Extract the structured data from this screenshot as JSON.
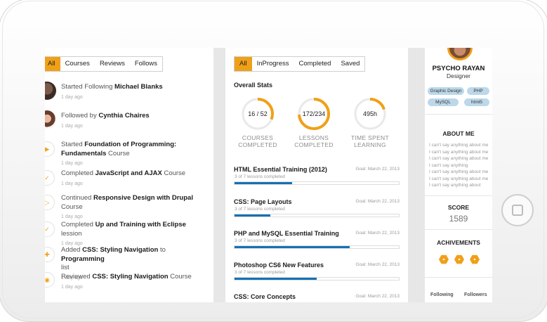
{
  "colors": {
    "accent": "#f0a018",
    "progress": "#1670b4",
    "tag": "#bcd8ea"
  },
  "left_tabs": [
    "All",
    "Courses",
    "Reviews",
    "Follows"
  ],
  "feed": [
    {
      "pre": "Started Following ",
      "bold1": "Michael Blanks",
      "mid": "",
      "bold2": "",
      "post": "",
      "time": "1 day ago",
      "icon": "avatar-icon"
    },
    {
      "pre": "Followed by ",
      "bold1": "Cynthia Chaires",
      "mid": "",
      "bold2": "",
      "post": "",
      "time": "1 day ago",
      "icon": "avatar-icon"
    },
    {
      "pre": "Started ",
      "bold1": "Foundation of Programming: Fundamentals",
      "mid": " Course",
      "bold2": "",
      "post": "",
      "time": "1 day ago",
      "icon": "play-icon"
    },
    {
      "pre": "Completed ",
      "bold1": "JavaScript and AJAX",
      "mid": " Course",
      "bold2": "",
      "post": "",
      "time": "1 day ago",
      "icon": "check-icon"
    },
    {
      "pre": "Continued ",
      "bold1": "Responsive Design with Drupal",
      "mid": " Course",
      "bold2": "",
      "post": "",
      "time": "1 day ago",
      "icon": "next-icon"
    },
    {
      "pre": "Completed ",
      "bold1": "Up and Training with Eclipse",
      "mid": " lession",
      "bold2": "",
      "post": "",
      "time": "1 day ago",
      "icon": "check-icon"
    },
    {
      "pre": "Added ",
      "bold1": "CSS: Styling Navigation",
      "mid": " to ",
      "bold2": "Programming",
      "post": " list",
      "time": "1 day ago",
      "icon": "plus-icon"
    },
    {
      "pre": "Reviewed ",
      "bold1": "CSS: Styling Navigation",
      "mid": " Course",
      "bold2": "",
      "post": "",
      "time": "1 day ago",
      "icon": "eye-icon"
    }
  ],
  "mid_tabs": [
    "All",
    "InProgress",
    "Completed",
    "Saved"
  ],
  "overall_stats_title": "Overall Stats",
  "stats": [
    {
      "value": "16 / 52",
      "label1": "COURSES",
      "label2": "COMPLETED",
      "fraction": 0.31
    },
    {
      "value": "172/234",
      "label1": "LESSONS",
      "label2": "COMPLETED",
      "fraction": 0.74
    },
    {
      "value": "495h",
      "label1": "TIME SPENT",
      "label2": "LEARNING",
      "fraction": 0.2
    }
  ],
  "courses": [
    {
      "title": "HTML Essential Training (2012)",
      "goal": "Goal: March 22, 2013",
      "sub": "3 of 7 lessons completed",
      "progress": 0.35
    },
    {
      "title": "CSS: Page Layouts",
      "goal": "Goal: March 22, 2013",
      "sub": "3 of 7 lessons completed",
      "progress": 0.22
    },
    {
      "title": "PHP and MySQL Essential Training",
      "goal": "Goal: March 22, 2013",
      "sub": "3 of 7 lessons completed",
      "progress": 0.7
    },
    {
      "title": "Photoshop CS6 New Features",
      "goal": "Goal: March 22, 2013",
      "sub": "3 of 7 lessons completed",
      "progress": 0.5
    },
    {
      "title": "CSS: Core Concepts",
      "goal": "Goal: March 22, 2013",
      "sub": "",
      "progress": 0
    }
  ],
  "profile": {
    "name": "PSYCHO RAYAN",
    "role": "Designer",
    "tags": [
      "Graphic Design",
      "PHP",
      "MySQL",
      "html5"
    ],
    "about_title": "ABOUT ME",
    "about_lines": [
      "I can't say anything about me",
      "I can't say anything about me",
      "I can't say anything about me",
      "I can't say anything",
      "I can't say anything about me",
      "I can't say anything about me",
      "I can't say anything about"
    ],
    "score_title": "SCORE",
    "score": "1589",
    "achievements_title": "ACHIVEMENTS",
    "following_label": "Following",
    "followers_label": "Followers"
  }
}
